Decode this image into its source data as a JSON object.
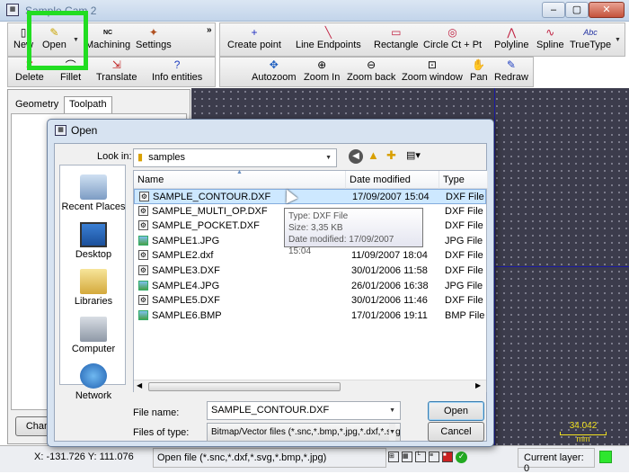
{
  "app": {
    "title": "Sample Cam 2",
    "main_toolbar": {
      "new": "New",
      "open": "Open",
      "machining": "Machining",
      "settings": "Settings",
      "delete": "Delete",
      "fillet": "Fillet",
      "translate": "Translate",
      "info": "Info entities"
    },
    "draw_toolbar": {
      "create_point": "Create point",
      "line_endpoints": "Line Endpoints",
      "rectangle": "Rectangle",
      "circle": "Circle Ct + Pt",
      "polyline": "Polyline",
      "spline": "Spline",
      "truetype": "TrueType"
    },
    "view_toolbar": {
      "autozoom": "Autozoom",
      "zoom_in": "Zoom In",
      "zoom_back": "Zoom back",
      "zoom_window": "Zoom window",
      "pan": "Pan",
      "redraw": "Redraw"
    },
    "tabs": {
      "geometry": "Geometry",
      "toolpath": "Toolpath"
    },
    "left_button": "Chan",
    "ruler": {
      "value": "34.042",
      "unit": "mm"
    },
    "status": {
      "coords": "X: -131.726 Y: 111.076",
      "message": "Open file (*.snc,*.dxf,*.svg,*.bmp,*.jpg)",
      "layer": "Current layer: 0"
    }
  },
  "dialog": {
    "title": "Open",
    "look_in_label": "Look in:",
    "look_in_value": "samples",
    "places": [
      "Recent Places",
      "Desktop",
      "Libraries",
      "Computer",
      "Network"
    ],
    "columns": {
      "name": "Name",
      "date": "Date modified",
      "type": "Type"
    },
    "files": [
      {
        "name": "SAMPLE_CONTOUR.DXF",
        "date": "17/09/2007 15:04",
        "type": "DXF File",
        "kind": "dxf"
      },
      {
        "name": "SAMPLE_MULTI_OP.DXF",
        "date": "",
        "type": "DXF File",
        "kind": "dxf"
      },
      {
        "name": "SAMPLE_POCKET.DXF",
        "date": "",
        "type": "DXF File",
        "kind": "dxf"
      },
      {
        "name": "SAMPLE1.JPG",
        "date": "",
        "type": "JPG File",
        "kind": "img"
      },
      {
        "name": "SAMPLE2.dxf",
        "date": "11/09/2007 18:04",
        "type": "DXF File",
        "kind": "dxf"
      },
      {
        "name": "SAMPLE3.DXF",
        "date": "30/01/2006 11:58",
        "type": "DXF File",
        "kind": "dxf"
      },
      {
        "name": "SAMPLE4.JPG",
        "date": "26/01/2006 16:38",
        "type": "JPG File",
        "kind": "img"
      },
      {
        "name": "SAMPLE5.DXF",
        "date": "30/01/2006 11:46",
        "type": "DXF File",
        "kind": "dxf"
      },
      {
        "name": "SAMPLE6.BMP",
        "date": "17/01/2006 19:11",
        "type": "BMP File",
        "kind": "img"
      }
    ],
    "tooltip": {
      "type": "Type: DXF File",
      "size": "Size: 3,35 KB",
      "date": "Date modified: 17/09/2007 15:04"
    },
    "file_name_label": "File name:",
    "file_name_value": "SAMPLE_CONTOUR.DXF",
    "file_type_label": "Files of type:",
    "file_type_value": "Bitmap/Vector files (*.snc,*.bmp,*.jpg,*.dxf,*.svg",
    "open_button": "Open",
    "cancel_button": "Cancel"
  },
  "highlight_color": "#22dd22"
}
